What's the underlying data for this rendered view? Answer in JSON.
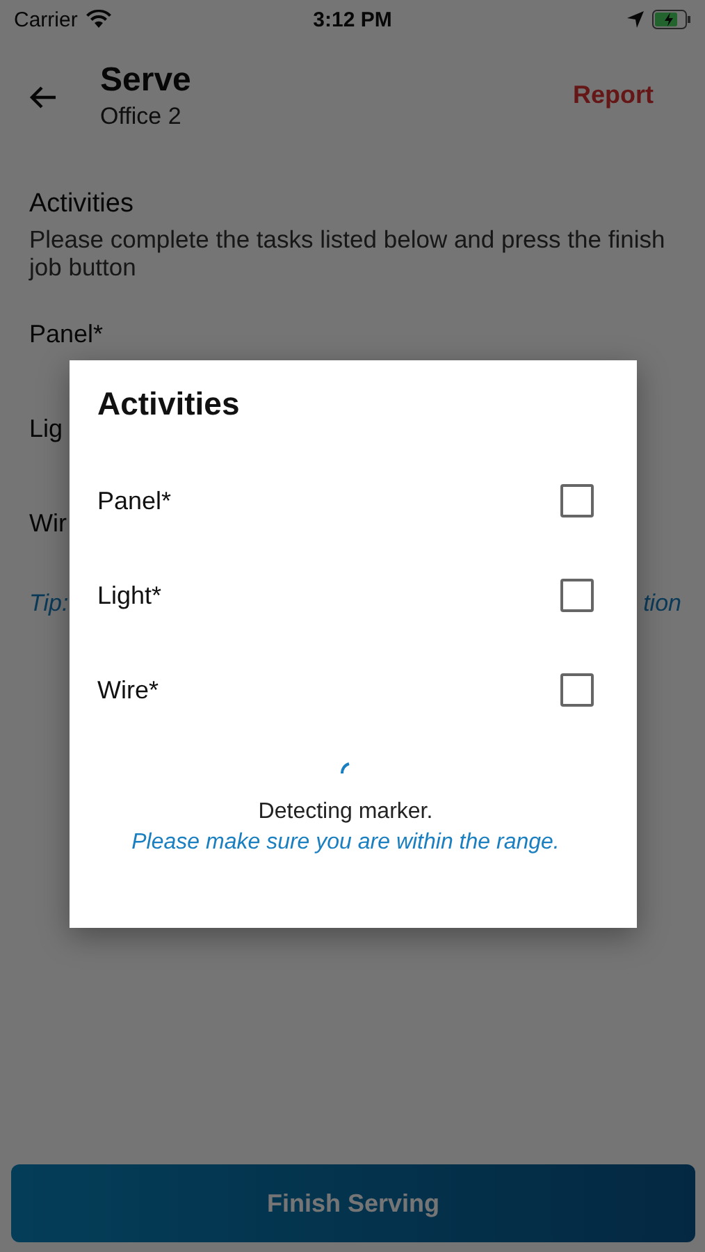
{
  "status_bar": {
    "carrier": "Carrier",
    "time": "3:12 PM"
  },
  "header": {
    "title": "Serve",
    "subtitle": "Office 2",
    "action": "Report"
  },
  "section": {
    "title": "Activities",
    "description": "Please complete the tasks listed below and press the finish job button"
  },
  "background_items": [
    {
      "label": "Panel*"
    },
    {
      "label": "Lig"
    },
    {
      "label": "Wir"
    }
  ],
  "tip": {
    "left": "Tip:",
    "right": "tion"
  },
  "dialog": {
    "title": "Activities",
    "items": [
      {
        "label": "Panel*",
        "checked": false
      },
      {
        "label": "Light*",
        "checked": false
      },
      {
        "label": "Wire*",
        "checked": false
      }
    ],
    "loading": true,
    "status": "Detecting marker.",
    "hint": "Please make sure you are within the range."
  },
  "finish_button": {
    "label": "Finish Serving"
  }
}
